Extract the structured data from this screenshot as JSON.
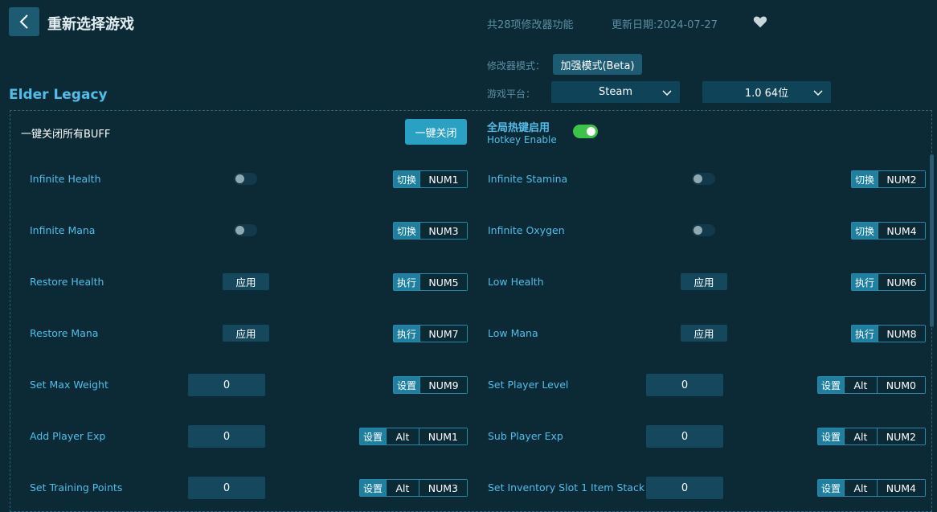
{
  "header": {
    "title": "重新选择游戏",
    "feature_count": "共28项修改器功能",
    "update_date": "更新日期:2024-07-27"
  },
  "mode": {
    "label": "修改器模式：",
    "value": "加强模式(Beta)"
  },
  "platform": {
    "label": "游戏平台：",
    "selected": "Steam",
    "version": "1.0 64位"
  },
  "game": {
    "name": "Elder Legacy"
  },
  "buff": {
    "title": "一键关闭所有BUFF",
    "close_all": "一键关闭"
  },
  "hotkey": {
    "title": "全局热键启用",
    "subtitle": "Hotkey Enable",
    "enabled": true
  },
  "features": [
    {
      "name": "Infinite Health",
      "control": "toggle",
      "action": "切换",
      "keys": [
        "NUM1"
      ]
    },
    {
      "name": "Infinite Stamina",
      "control": "toggle",
      "action": "切换",
      "keys": [
        "NUM2"
      ]
    },
    {
      "name": "Infinite Mana",
      "control": "toggle",
      "action": "切换",
      "keys": [
        "NUM3"
      ]
    },
    {
      "name": "Infinite Oxygen",
      "control": "toggle",
      "action": "切换",
      "keys": [
        "NUM4"
      ]
    },
    {
      "name": "Restore Health",
      "control": "button",
      "button_label": "应用",
      "action": "执行",
      "keys": [
        "NUM5"
      ]
    },
    {
      "name": "Low Health",
      "control": "button",
      "button_label": "应用",
      "action": "执行",
      "keys": [
        "NUM6"
      ]
    },
    {
      "name": "Restore Mana",
      "control": "button",
      "button_label": "应用",
      "action": "执行",
      "keys": [
        "NUM7"
      ]
    },
    {
      "name": "Low Mana",
      "control": "button",
      "button_label": "应用",
      "action": "执行",
      "keys": [
        "NUM8"
      ]
    },
    {
      "name": "Set Max Weight",
      "control": "input",
      "value": "0",
      "action": "设置",
      "keys": [
        "NUM9"
      ]
    },
    {
      "name": "Set Player Level",
      "control": "input",
      "value": "0",
      "action": "设置",
      "keys": [
        "Alt",
        "NUM0"
      ]
    },
    {
      "name": "Add Player Exp",
      "control": "input",
      "value": "0",
      "action": "设置",
      "keys": [
        "Alt",
        "NUM1"
      ]
    },
    {
      "name": "Sub Player Exp",
      "control": "input",
      "value": "0",
      "action": "设置",
      "keys": [
        "Alt",
        "NUM2"
      ]
    },
    {
      "name": "Set Training Points",
      "control": "input",
      "value": "0",
      "action": "设置",
      "keys": [
        "Alt",
        "NUM3"
      ]
    },
    {
      "name": "Set Inventory Slot 1 Item Stack",
      "control": "input",
      "value": "0",
      "action": "设置",
      "keys": [
        "Alt",
        "NUM4"
      ]
    }
  ],
  "colors": {
    "background": "#0b2a36",
    "accent": "#52bde8",
    "button": "#2aa0c2",
    "toggle_on": "#3cc44a"
  }
}
